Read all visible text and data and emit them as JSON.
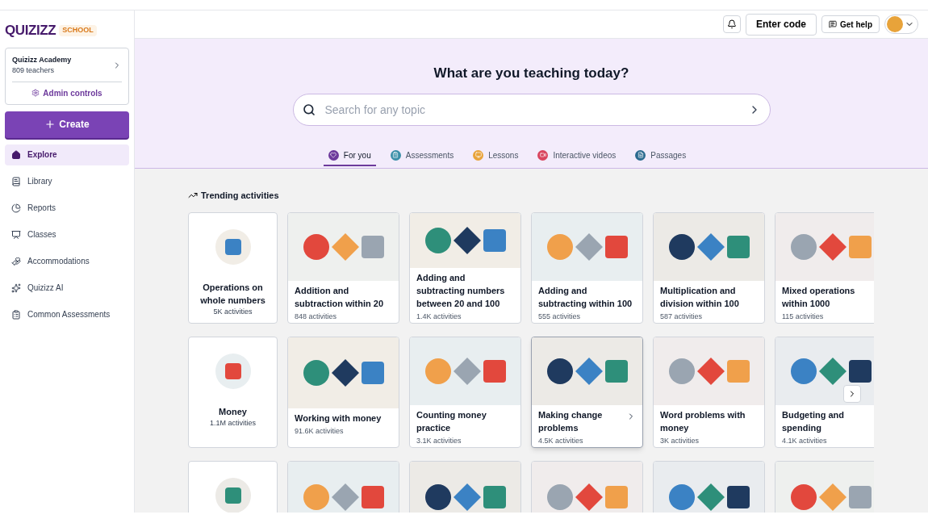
{
  "brand": {
    "logo": "QUIZIZZ",
    "badge": "SCHOOL"
  },
  "org": {
    "name": "Quizizz Academy",
    "members": "809 teachers",
    "admin": "Admin controls"
  },
  "create_button": "Create",
  "nav": [
    {
      "label": "Explore",
      "selected": true
    },
    {
      "label": "Library",
      "selected": false
    },
    {
      "label": "Reports",
      "selected": false
    },
    {
      "label": "Classes",
      "selected": false
    },
    {
      "label": "Accommodations",
      "selected": false
    },
    {
      "label": "Quizizz AI",
      "selected": false
    },
    {
      "label": "Common Assessments",
      "selected": false
    }
  ],
  "header": {
    "enter_code": "Enter code",
    "help": "Get help"
  },
  "hero": {
    "title": "What are you teaching today?",
    "search": {
      "placeholder": "Search for any topic"
    }
  },
  "tabs": [
    {
      "label": "For you",
      "color": "#6d3a9c",
      "selected": true
    },
    {
      "label": "Assessments",
      "color": "#3a8fa8",
      "selected": false
    },
    {
      "label": "Lessons",
      "color": "#e8a33a",
      "selected": false
    },
    {
      "label": "Interactive videos",
      "color": "#d9455f",
      "selected": false
    },
    {
      "label": "Passages",
      "color": "#2a6a8f",
      "selected": false
    }
  ],
  "section": {
    "title": "Trending activities"
  },
  "rows": [
    {
      "cards": [
        {
          "kind": "topic",
          "title": "Operations on whole numbers",
          "count": "5K activities"
        },
        {
          "kind": "image",
          "title": "Addition and subtraction within 20",
          "count": "848 activities",
          "hovered": false
        },
        {
          "kind": "image",
          "title": "Adding and subtracting numbers between 20 and 100",
          "count": "1.4K activities",
          "hovered": false
        },
        {
          "kind": "image",
          "title": "Adding and subtracting within 100",
          "count": "555 activities",
          "hovered": false
        },
        {
          "kind": "image",
          "title": "Multiplication and division within 100",
          "count": "587 activities",
          "hovered": false
        },
        {
          "kind": "image",
          "title": "Mixed operations within 1000",
          "count": "115 activities",
          "hovered": false
        }
      ]
    },
    {
      "cards": [
        {
          "kind": "topic",
          "title": "Money",
          "count": "1.1M activities"
        },
        {
          "kind": "image",
          "title": "Working with money",
          "count": "91.6K activities",
          "hovered": false
        },
        {
          "kind": "image",
          "title": "Counting money practice",
          "count": "3.1K activities",
          "hovered": false
        },
        {
          "kind": "image",
          "title": "Making change problems",
          "count": "4.5K activities",
          "hovered": true
        },
        {
          "kind": "image",
          "title": "Word problems with money",
          "count": "3K activities",
          "hovered": false
        },
        {
          "kind": "image",
          "title": "Budgeting and spending",
          "count": "4.1K activities",
          "hovered": false
        }
      ],
      "next_button": true
    },
    {
      "cards": [
        {
          "kind": "topic"
        },
        {
          "kind": "image"
        },
        {
          "kind": "image"
        },
        {
          "kind": "image"
        },
        {
          "kind": "image"
        },
        {
          "kind": "image"
        }
      ]
    }
  ]
}
